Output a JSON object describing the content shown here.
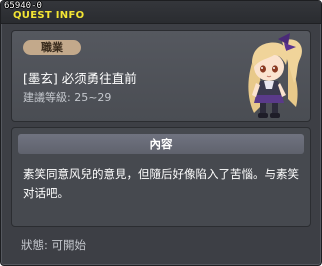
{
  "window": {
    "quest_id": "65940-0",
    "title": "QUEST INFO"
  },
  "quest": {
    "job_badge": "職業",
    "name": "[墨玄] 必须勇往直前",
    "level_recommendation": "建議等級: 25~29"
  },
  "content": {
    "header": "內容",
    "description": "素笑同意风兒的意見，但隨后好像陷入了苦惱。与素笑对话吧。"
  },
  "status": {
    "text": "狀態: 可開始"
  },
  "colors": {
    "title_accent": "#f3e534",
    "badge_bg": "#c3a98b",
    "panel_bg": "#4a4d53",
    "header_bg": "#6a6d78"
  }
}
